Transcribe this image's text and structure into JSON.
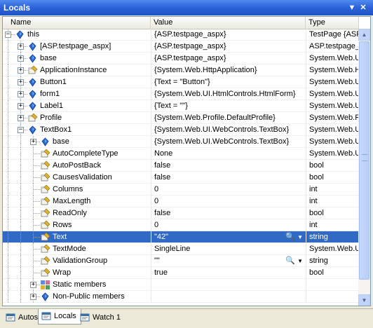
{
  "window": {
    "title": "Locals"
  },
  "columns": {
    "name": "Name",
    "value": "Value",
    "type": "Type"
  },
  "rows": [
    {
      "label": "this",
      "value": "{ASP.testpage_aspx}",
      "type": "TestPage {ASP",
      "depth": 0,
      "expander": "minus",
      "icon": "field-icon"
    },
    {
      "label": "[ASP.testpage_aspx]",
      "value": "{ASP.testpage_aspx}",
      "type": "ASP.testpage_",
      "depth": 1,
      "expander": "plus",
      "icon": "field-icon"
    },
    {
      "label": "base",
      "value": "{ASP.testpage_aspx}",
      "type": "System.Web.U",
      "depth": 1,
      "expander": "plus",
      "icon": "field-icon"
    },
    {
      "label": "ApplicationInstance",
      "value": "{System.Web.HttpApplication}",
      "type": "System.Web.H",
      "depth": 1,
      "expander": "plus",
      "icon": "property-icon"
    },
    {
      "label": "Button1",
      "value": "{Text = \"Button\"}",
      "type": "System.Web.U",
      "depth": 1,
      "expander": "plus",
      "icon": "field-icon"
    },
    {
      "label": "form1",
      "value": "{System.Web.UI.HtmlControls.HtmlForm}",
      "type": "System.Web.U",
      "depth": 1,
      "expander": "plus",
      "icon": "field-icon"
    },
    {
      "label": "Label1",
      "value": "{Text = \"\"}",
      "type": "System.Web.U",
      "depth": 1,
      "expander": "plus",
      "icon": "field-icon"
    },
    {
      "label": "Profile",
      "value": "{System.Web.Profile.DefaultProfile}",
      "type": "System.Web.P",
      "depth": 1,
      "expander": "plus",
      "icon": "property-icon"
    },
    {
      "label": "TextBox1",
      "value": "{System.Web.UI.WebControls.TextBox}",
      "type": "System.Web.U",
      "depth": 1,
      "expander": "minus",
      "icon": "field-icon"
    },
    {
      "label": "base",
      "value": "{System.Web.UI.WebControls.TextBox}",
      "type": "System.Web.U",
      "depth": 2,
      "expander": "plus",
      "icon": "field-icon"
    },
    {
      "label": "AutoCompleteType",
      "value": "None",
      "type": "System.Web.U",
      "depth": 2,
      "expander": "none",
      "icon": "property-icon"
    },
    {
      "label": "AutoPostBack",
      "value": "false",
      "type": "bool",
      "depth": 2,
      "expander": "none",
      "icon": "property-icon"
    },
    {
      "label": "CausesValidation",
      "value": "false",
      "type": "bool",
      "depth": 2,
      "expander": "none",
      "icon": "property-icon"
    },
    {
      "label": "Columns",
      "value": "0",
      "type": "int",
      "depth": 2,
      "expander": "none",
      "icon": "property-icon"
    },
    {
      "label": "MaxLength",
      "value": "0",
      "type": "int",
      "depth": 2,
      "expander": "none",
      "icon": "property-icon"
    },
    {
      "label": "ReadOnly",
      "value": "false",
      "type": "bool",
      "depth": 2,
      "expander": "none",
      "icon": "property-icon"
    },
    {
      "label": "Rows",
      "value": "0",
      "type": "int",
      "depth": 2,
      "expander": "none",
      "icon": "property-icon"
    },
    {
      "label": "Text",
      "value": "\"42\"",
      "type": "string",
      "depth": 2,
      "expander": "none",
      "icon": "property-icon",
      "selected": true,
      "visualizer": true
    },
    {
      "label": "TextMode",
      "value": "SingleLine",
      "type": "System.Web.U",
      "depth": 2,
      "expander": "none",
      "icon": "property-icon"
    },
    {
      "label": "ValidationGroup",
      "value": "\"\"",
      "type": "string",
      "depth": 2,
      "expander": "none",
      "icon": "property-icon",
      "visualizer": true
    },
    {
      "label": "Wrap",
      "value": "true",
      "type": "bool",
      "depth": 2,
      "expander": "none",
      "icon": "property-icon"
    },
    {
      "label": "Static members",
      "value": "",
      "type": "",
      "depth": 2,
      "expander": "plus",
      "icon": "static-members-icon"
    },
    {
      "label": "Non-Public members",
      "value": "",
      "type": "",
      "depth": 2,
      "expander": "plus",
      "icon": "field-icon"
    }
  ],
  "tabs": [
    {
      "label": "Autos",
      "icon": "autos-window-icon"
    },
    {
      "label": "Locals",
      "icon": "locals-window-icon",
      "active": true
    },
    {
      "label": "Watch 1",
      "icon": "watch-window-icon"
    }
  ],
  "colors": {
    "title_bar": "#2b62d9",
    "selection": "#316ac5",
    "field_icon": "#2a6ad9",
    "property_icon": "#e0b030"
  }
}
